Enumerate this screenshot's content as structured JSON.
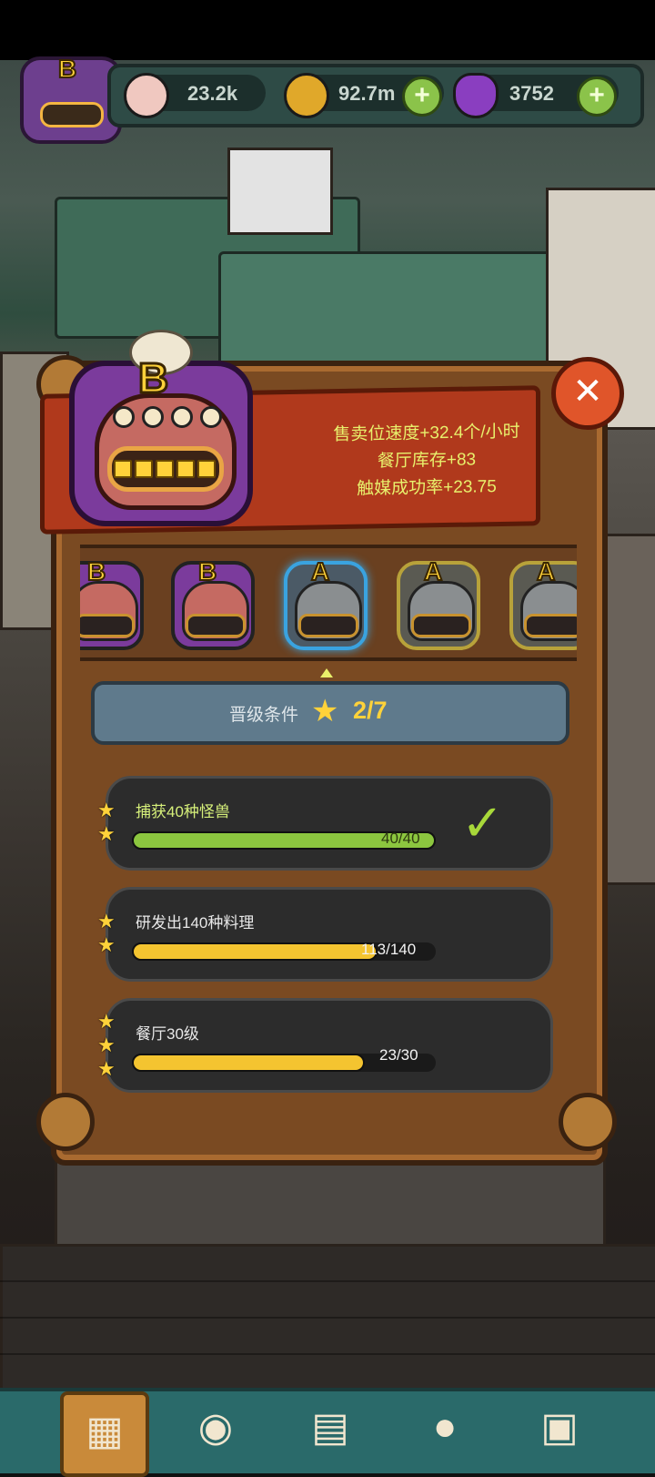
{
  "resources": [
    {
      "name": "eyeball",
      "value": "23.2k",
      "has_plus": false
    },
    {
      "name": "coin",
      "value": "92.7m",
      "has_plus": true
    },
    {
      "name": "potion",
      "value": "3752",
      "has_plus": true
    }
  ],
  "player_badge": {
    "grade": "B"
  },
  "panel": {
    "monster_grade": "B",
    "bonuses": [
      "售卖位速度+32.4个/小时",
      "餐厅库存+83",
      "触媒成功率+23.75"
    ],
    "carousel": [
      {
        "grade": "B",
        "state": "unlocked"
      },
      {
        "grade": "B",
        "state": "unlocked"
      },
      {
        "grade": "A",
        "state": "selected"
      },
      {
        "grade": "A",
        "state": "locked"
      },
      {
        "grade": "A",
        "state": "locked"
      }
    ],
    "requirements_label": "晋级条件",
    "requirements_count": "2/7",
    "requirements": [
      {
        "title": "捕获40种怪兽",
        "progress": "40/40",
        "fraction": 1.0,
        "stars": 2,
        "complete": true
      },
      {
        "title": "研发出140种料理",
        "progress": "113/140",
        "fraction": 0.807,
        "stars": 2,
        "complete": false
      },
      {
        "title": "餐厅30级",
        "progress": "23/30",
        "fraction": 0.767,
        "stars": 3,
        "complete": false
      }
    ]
  },
  "colors": {
    "progress_done": "#8cc63f",
    "progress_pending": "#f4c430",
    "banner": "#b0391c",
    "bonus_text": "#e8f06c"
  },
  "icons": {
    "close": "close-icon",
    "check": "checkmark-icon",
    "star": "star-icon",
    "plus": "plus-icon"
  },
  "bottom_nav": [
    "restaurant-icon",
    "cauldron-icon",
    "recipe-book-icon",
    "money-bag-icon",
    "inventory-grid-icon"
  ]
}
